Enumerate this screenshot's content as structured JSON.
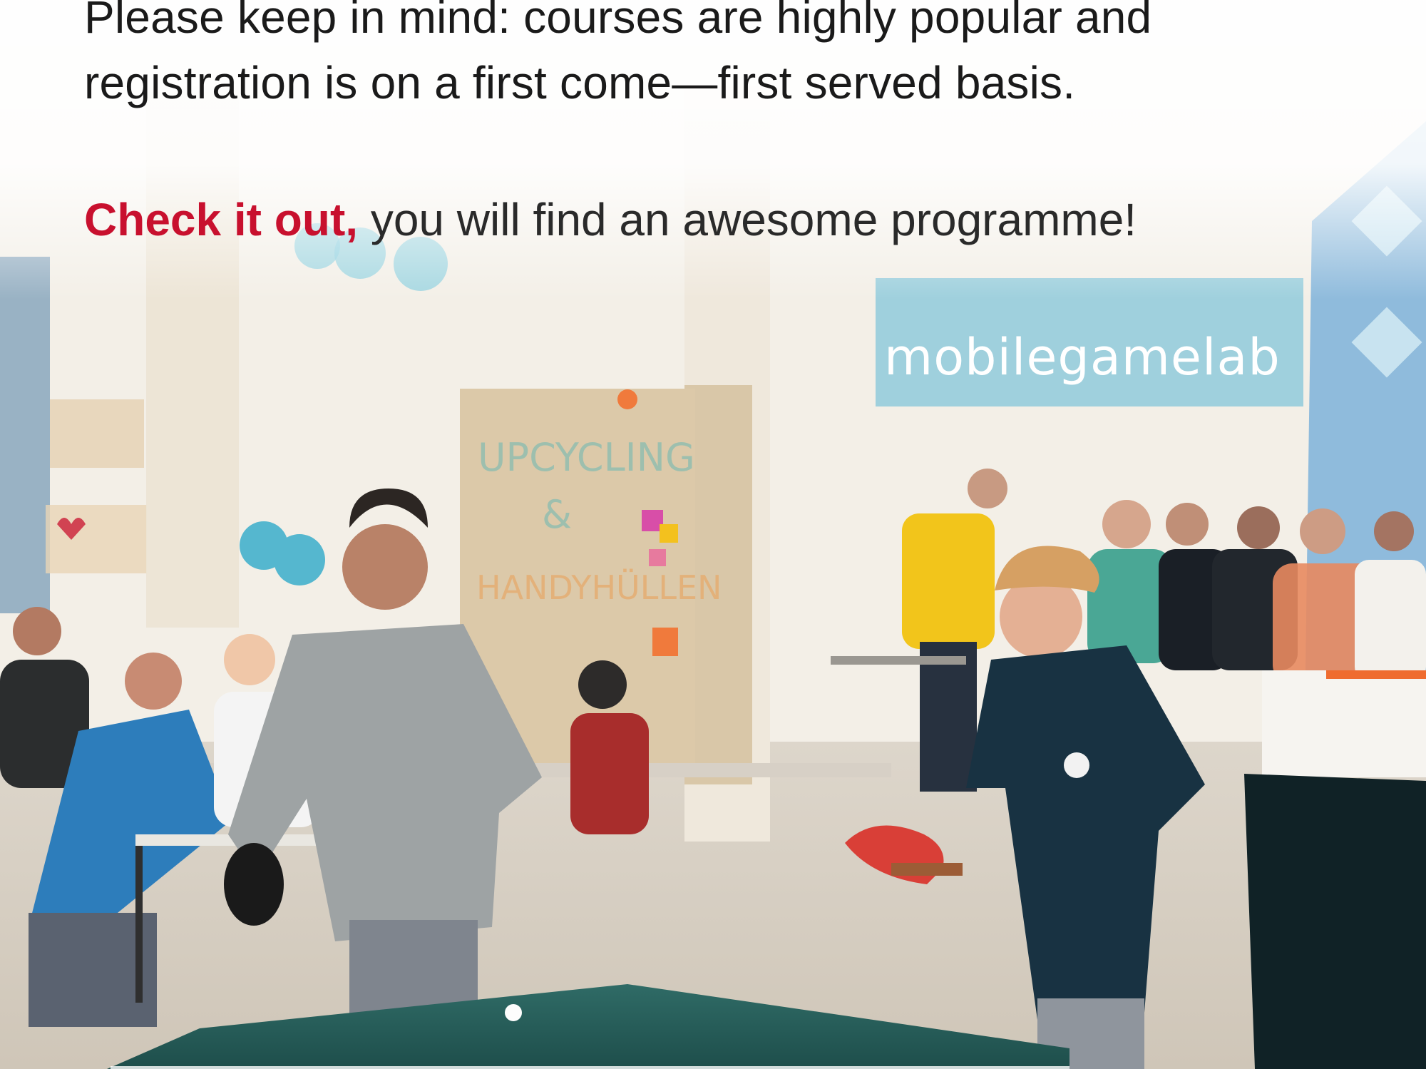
{
  "intro": {
    "line1": "Please keep in mind: courses are highly popular and",
    "line2": "registration is on a first come—first served basis."
  },
  "cta": {
    "highlight": "Check it out,",
    "rest": " you will find an awesome programme!"
  },
  "photo": {
    "banner_text": "mobilegamelab",
    "pillar_sign_top": "UPCYCLING",
    "pillar_sign_mid": "&",
    "pillar_sign_bottom": "HANDYHÜLLEN"
  },
  "colors": {
    "accent": "#c8102e",
    "text": "#1a1a1a",
    "banner": "#9fd0dd"
  }
}
